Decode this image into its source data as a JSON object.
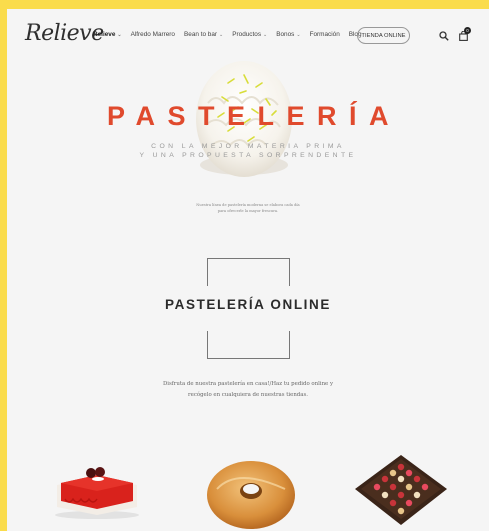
{
  "header": {
    "logo_text": "Relieve",
    "nav": [
      {
        "label": "Relieve",
        "has_menu": true,
        "bold": true
      },
      {
        "label": "Alfredo Marrero",
        "has_menu": false,
        "bold": false
      },
      {
        "label": "Bean to bar",
        "has_menu": true,
        "bold": false
      },
      {
        "label": "Productos",
        "has_menu": true,
        "bold": false
      },
      {
        "label": "Bonos",
        "has_menu": true,
        "bold": false
      },
      {
        "label": "Formación",
        "has_menu": false,
        "bold": false
      },
      {
        "label": "Blog",
        "has_menu": false,
        "bold": false
      }
    ],
    "shop_button": "TIENDA ONLINE",
    "cart_count": "0"
  },
  "hero": {
    "title": "PASTELERÍA",
    "subtitle_line1": "CON LA MEJOR MATERIA PRIMA",
    "subtitle_line2": "Y UNA PROPUESTA SORPRENDENTE",
    "note_line1": "Nuestra línea de pastelería moderna se elabora cada día",
    "note_line2": "para ofrecerle la mayor frescura."
  },
  "online": {
    "title": "PASTELERÍA ONLINE",
    "desc_line1": "Disfruta de nuestra pastelería en casa!/Haz tu pedido online y",
    "desc_line2": "recógelo en cualquiera de nuestras tiendas."
  },
  "colors": {
    "accent": "#e04a2d",
    "frame": "#fadc4c",
    "background": "#f5f5f5"
  },
  "icons": [
    "search-icon",
    "bag-icon",
    "chevron-down-icon"
  ]
}
